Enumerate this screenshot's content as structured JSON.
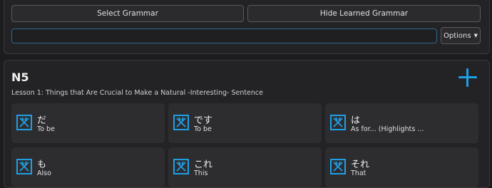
{
  "toolbar": {
    "select_grammar_label": "Select Grammar",
    "hide_learned_label": "Hide Learned Grammar",
    "search_value": "",
    "options_label": "Options"
  },
  "section": {
    "level": "N5",
    "lesson_prefix": "Lesson 1:",
    "lesson_title": "Things that Are Crucial to Make a Natural -Interesting- Sentence"
  },
  "cards": [
    {
      "jp": "だ",
      "en": "To be"
    },
    {
      "jp": "です",
      "en": "To be"
    },
    {
      "jp": "は",
      "en": "As for... (Highlights ..."
    },
    {
      "jp": "も",
      "en": "Also"
    },
    {
      "jp": "これ",
      "en": "This"
    },
    {
      "jp": "それ",
      "en": "That"
    }
  ],
  "colors": {
    "accent": "#1fa0e6",
    "background": "#1c1c1e",
    "panel": "#232325",
    "card": "#2d2d30"
  },
  "icons": {
    "card_icon": "kanji-diagram-icon",
    "add": "plus-icon",
    "dropdown": "caret-down-icon"
  }
}
